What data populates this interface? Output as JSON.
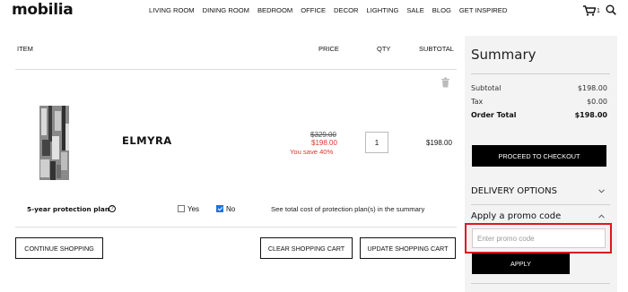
{
  "header": {
    "logo": "mobilia",
    "nav": [
      "LIVING ROOM",
      "DINING ROOM",
      "BEDROOM",
      "OFFICE",
      "DECOR",
      "LIGHTING",
      "SALE",
      "BLOG",
      "GET INSPIRED"
    ],
    "cart_count": "1"
  },
  "cart_table": {
    "headers": {
      "item": "ITEM",
      "price": "PRICE",
      "qty": "QTY",
      "subtotal": "SUBTOTAL"
    },
    "item": {
      "name": "ELMYRA",
      "price_original": "$329.00",
      "price_sale": "$198.00",
      "you_save": "You save 40%",
      "quantity": "1",
      "subtotal": "$198.00"
    },
    "protection": {
      "label": "5-year protection plan",
      "help": "?",
      "yes_label": "Yes",
      "no_label": "No",
      "note": "See total cost of protection plan(s) in the summary"
    },
    "buttons": {
      "continue": "CONTINUE SHOPPING",
      "clear": "CLEAR SHOPPING CART",
      "update": "UPDATE SHOPPING CART"
    }
  },
  "summary": {
    "title": "Summary",
    "subtotal_label": "Subtotal",
    "subtotal_value": "$198.00",
    "tax_label": "Tax",
    "tax_value": "$0.00",
    "order_total_label": "Order Total",
    "order_total_value": "$198.00",
    "checkout_button": "PROCEED TO CHECKOUT",
    "delivery_options": "DELIVERY OPTIONS",
    "promo_title": "Apply a promo code",
    "promo_placeholder": "Enter promo code",
    "apply_button": "APPLY"
  },
  "icons": {
    "cart": "shopping-cart-icon",
    "search": "search-icon",
    "trash": "trash-icon",
    "chevron_down": "chevron-down-icon",
    "chevron_up": "chevron-up-icon"
  },
  "colors": {
    "sale_red": "#d9382e",
    "highlight_red": "#e0161e",
    "checkbox_blue": "#1a73e8",
    "summary_bg": "#f3f3f3"
  }
}
